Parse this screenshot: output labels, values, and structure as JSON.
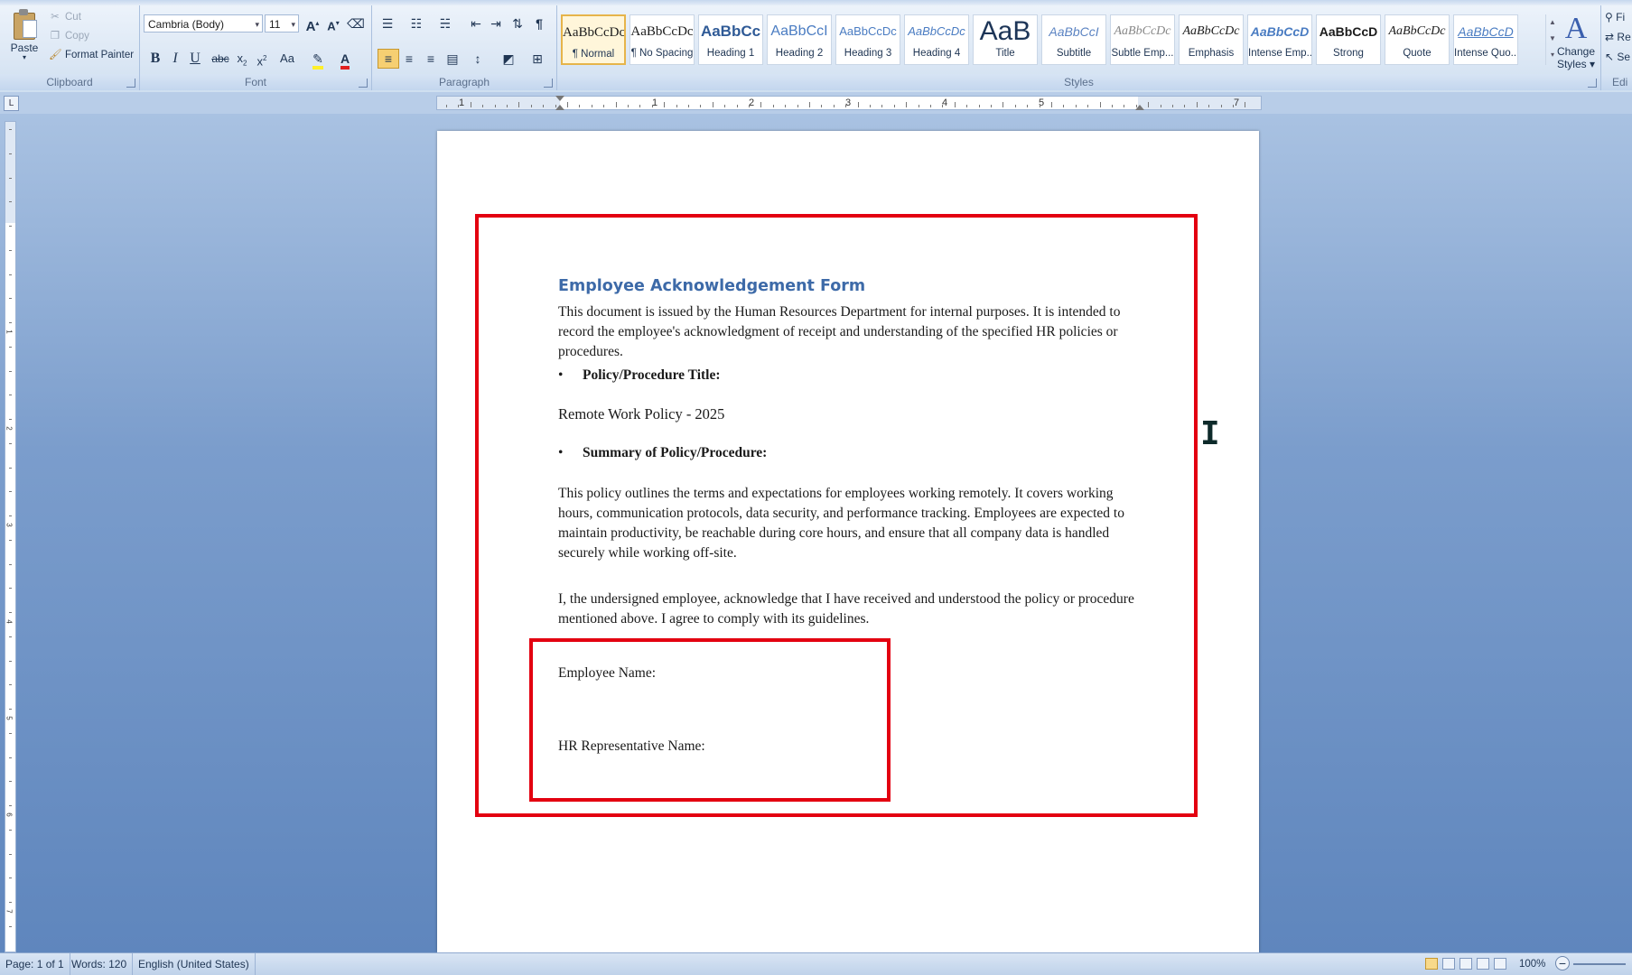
{
  "ribbon": {
    "clipboard": {
      "label": "Clipboard",
      "paste": "Paste",
      "cut": "Cut",
      "copy": "Copy",
      "format_painter": "Format Painter"
    },
    "font": {
      "label": "Font",
      "font_name": "Cambria (Body)",
      "font_size": "11",
      "change_case": "Aa"
    },
    "paragraph": {
      "label": "Paragraph"
    },
    "styles": {
      "label": "Styles",
      "items": [
        {
          "sample": "AaBbCcDc",
          "name": "¶ Normal"
        },
        {
          "sample": "AaBbCcDc",
          "name": "¶ No Spacing"
        },
        {
          "sample": "AaBbCc",
          "name": "Heading 1"
        },
        {
          "sample": "AaBbCcI",
          "name": "Heading 2"
        },
        {
          "sample": "AaBbCcDc",
          "name": "Heading 3"
        },
        {
          "sample": "AaBbCcDc",
          "name": "Heading 4"
        },
        {
          "sample": "AaB",
          "name": "Title"
        },
        {
          "sample": "AaBbCcI",
          "name": "Subtitle"
        },
        {
          "sample": "AaBbCcDc",
          "name": "Subtle Emp..."
        },
        {
          "sample": "AaBbCcDc",
          "name": "Emphasis"
        },
        {
          "sample": "AaBbCcD",
          "name": "Intense Emp..."
        },
        {
          "sample": "AaBbCcD",
          "name": "Strong"
        },
        {
          "sample": "AaBbCcDc",
          "name": "Quote"
        },
        {
          "sample": "AaBbCcD",
          "name": "Intense Quo..."
        }
      ],
      "change_styles_glyph": "A",
      "change_styles_line1": "Change",
      "change_styles_line2": "Styles ▾"
    },
    "editing": {
      "label": "Edi",
      "find": "Fi",
      "replace": "Re",
      "select": "Se"
    }
  },
  "ruler": {
    "corner": "L",
    "h_numbers": [
      "1",
      "1",
      "2",
      "3",
      "4",
      "5",
      "7"
    ],
    "v_numbers": [
      "1",
      "2",
      "3",
      "4",
      "5",
      "6",
      "7"
    ]
  },
  "document": {
    "title": "Employee Acknowledgement Form",
    "intro": "This document is issued by the Human Resources Department for internal purposes. It is intended to record the employee's acknowledgment of receipt and understanding of the specified HR policies or procedures.",
    "bullet1": "Policy/Procedure Title:",
    "policy_title": "Remote Work Policy - 2025",
    "bullet2": "Summary of Policy/Procedure:",
    "summary": "This policy outlines the terms and expectations for employees working remotely. It covers working hours, communication protocols, data security, and performance tracking. Employees are expected to maintain productivity, be reachable during core hours, and ensure that all company data is handled securely while working off-site.",
    "acknowledgement": "I, the undersigned employee, acknowledge that I have received and understood the policy or procedure mentioned above. I agree to comply with its guidelines.",
    "employee_name_label": "Employee Name:",
    "hr_name_label": "HR Representative Name:",
    "bullet_glyph": "•"
  },
  "status": {
    "page": "Page: 1 of 1",
    "words": "Words: 120",
    "language": "English (United States)",
    "zoom": "100%"
  },
  "colors": {
    "accent_red": "#e30010",
    "title_blue": "#3d6aa8",
    "workspace_blue": "#6f95c6"
  }
}
